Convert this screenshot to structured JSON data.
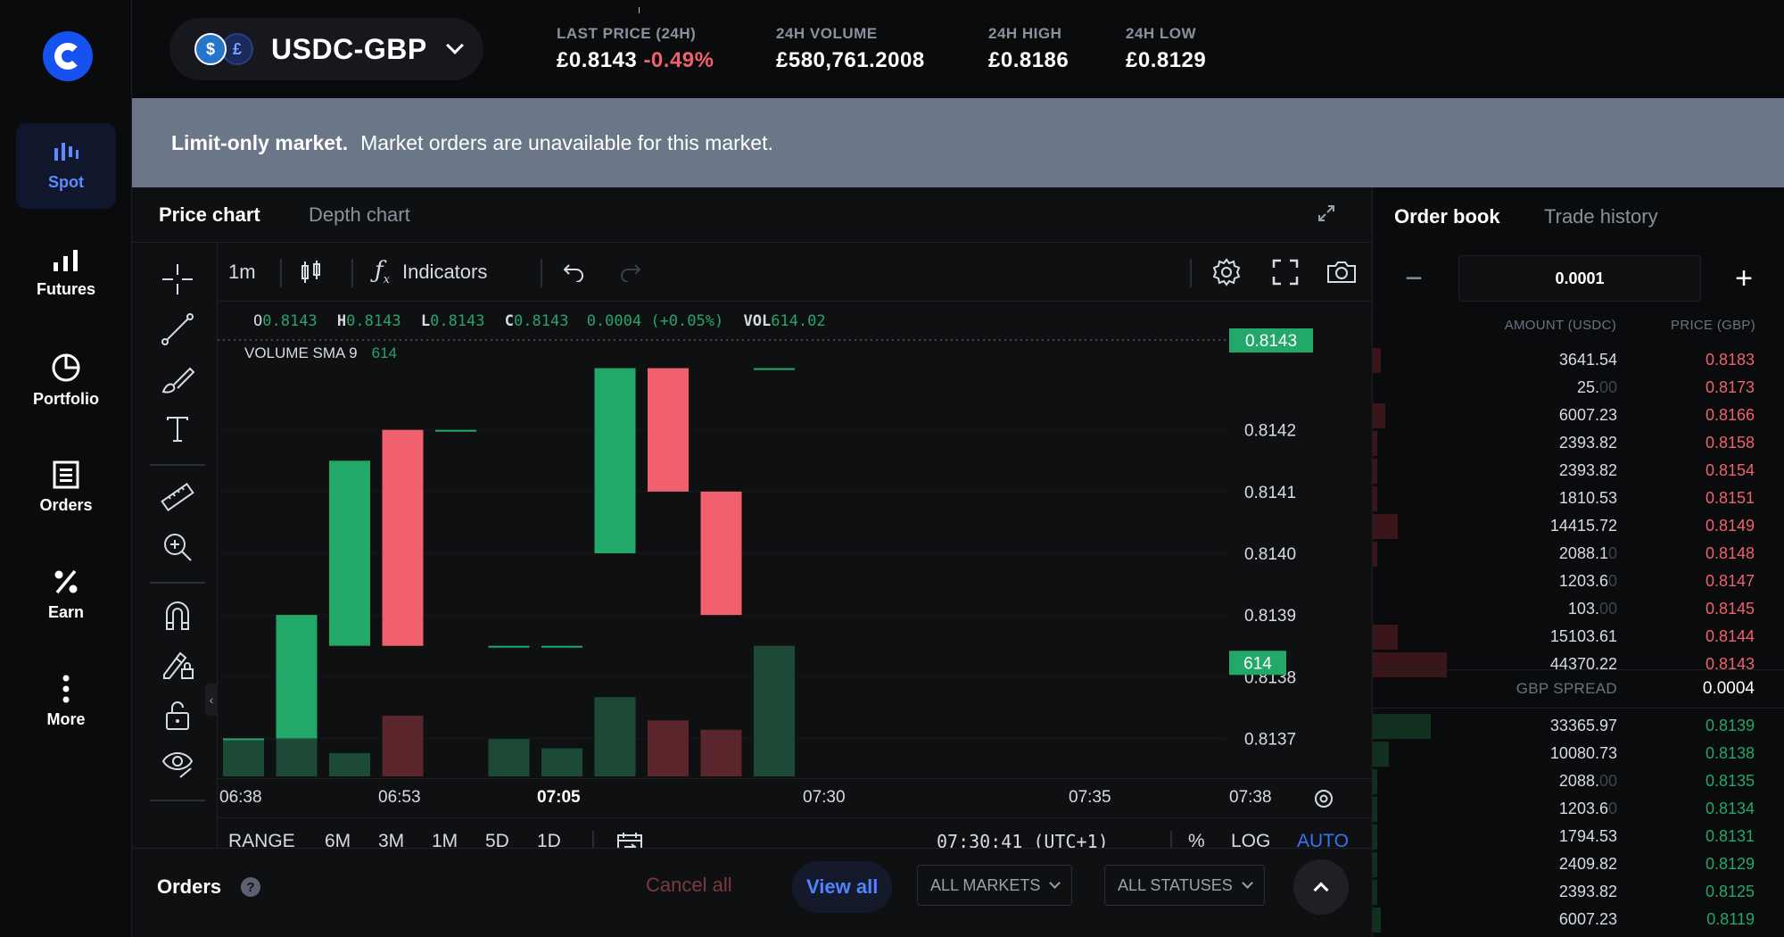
{
  "sidebar": {
    "items": [
      {
        "label": "Spot",
        "icon": "candlestick-icon"
      },
      {
        "label": "Futures",
        "icon": "bar-chart-icon"
      },
      {
        "label": "Portfolio",
        "icon": "pie-chart-icon"
      },
      {
        "label": "Orders",
        "icon": "document-list-icon"
      },
      {
        "label": "Earn",
        "icon": "percent-icon"
      },
      {
        "label": "More",
        "icon": "more-vertical-icon"
      }
    ]
  },
  "header": {
    "pair": "USDC-GBP",
    "coin_glyphs": {
      "base": "$",
      "quote": "£"
    },
    "stats": [
      {
        "key": "LAST PRICE (24H)",
        "value": "£0.8143",
        "change": "-0.49%"
      },
      {
        "key": "24H VOLUME",
        "value": "£580,761.2008"
      },
      {
        "key": "24H HIGH",
        "value": "£0.8186"
      },
      {
        "key": "24H LOW",
        "value": "£0.8129"
      }
    ]
  },
  "banner": {
    "bold": "Limit-only market.",
    "text": "Market orders are unavailable for this market."
  },
  "chart_tabs": {
    "price": "Price chart",
    "depth": "Depth chart"
  },
  "toolbar": {
    "interval": "1m",
    "indicators": "Indicators"
  },
  "ohlc": {
    "o_key": "O",
    "o": "0.8143",
    "h_key": "H",
    "h": "0.8143",
    "l_key": "L",
    "l": "0.8143",
    "c_key": "C",
    "c": "0.8143",
    "change": "0.0004 (+0.05%)",
    "vol_key": "VOL",
    "vol": "614.02"
  },
  "sma": {
    "label": "VOLUME SMA 9",
    "value": "614"
  },
  "price_tags": {
    "last": "0.8143",
    "volume": "614"
  },
  "colors": {
    "up": "#22a868",
    "down": "#f0616d",
    "up_vol": "#1d4a37",
    "down_vol": "#5a252b",
    "accent": "#3773f5"
  },
  "range_bar": {
    "range_label": "RANGE",
    "ranges": [
      "6M",
      "3M",
      "1M",
      "5D",
      "1D"
    ],
    "clock": "07:30:41 (UTC+1)",
    "percent": "%",
    "log": "LOG",
    "auto": "AUTO"
  },
  "chart_data": {
    "type": "candlestick",
    "y_ticks": [
      "0.8142",
      "0.8141",
      "0.8140",
      "0.8139",
      "0.8138",
      "0.8137"
    ],
    "ylim": [
      0.81365,
      0.81435
    ],
    "x_ticks": [
      {
        "label": "06:38",
        "bold": false
      },
      {
        "label": "06:53",
        "bold": false
      },
      {
        "label": "07:05",
        "bold": true
      },
      {
        "label": "07:30",
        "bold": false
      },
      {
        "label": "07:35",
        "bold": false
      },
      {
        "label": "07:38",
        "bold": false
      }
    ],
    "candles": [
      {
        "o": 0.8137,
        "c": 0.8137,
        "vol_frac": 0.08
      },
      {
        "o": 0.8137,
        "c": 0.8139,
        "vol_frac": 0.15
      },
      {
        "o": 0.81385,
        "c": 0.81415,
        "vol_frac": 0.05
      },
      {
        "o": 0.8142,
        "c": 0.81385,
        "vol_frac": 0.13
      },
      {
        "o": 0.8142,
        "c": 0.8142,
        "vol_frac": 0.0
      },
      {
        "o": 0.81385,
        "c": 0.81385,
        "vol_frac": 0.08
      },
      {
        "o": 0.81385,
        "c": 0.81385,
        "vol_frac": 0.06
      },
      {
        "o": 0.814,
        "c": 0.8143,
        "vol_frac": 0.17
      },
      {
        "o": 0.8143,
        "c": 0.8141,
        "vol_frac": 0.12
      },
      {
        "o": 0.8141,
        "c": 0.8139,
        "vol_frac": 0.1
      },
      {
        "o": 0.8143,
        "c": 0.8143,
        "vol_frac": 0.28
      }
    ]
  },
  "orders": {
    "title": "Orders",
    "help": "?",
    "cancel_all": "Cancel all",
    "view_all": "View all",
    "markets": "ALL MARKETS",
    "statuses": "ALL STATUSES"
  },
  "order_book": {
    "tabs": {
      "book": "Order book",
      "history": "Trade history"
    },
    "step": "0.0001",
    "minus": "−",
    "plus": "+",
    "amount_header": "AMOUNT (USDC)",
    "price_header": "PRICE (GBP)",
    "asks": [
      {
        "amount": "3641.54",
        "dim": "",
        "price": "0.8183",
        "depth": 0.02
      },
      {
        "amount": "25.",
        "dim": "00",
        "price": "0.8173",
        "depth": 0.0
      },
      {
        "amount": "6007.23",
        "dim": "",
        "price": "0.8166",
        "depth": 0.03
      },
      {
        "amount": "2393.82",
        "dim": "",
        "price": "0.8158",
        "depth": 0.01
      },
      {
        "amount": "2393.82",
        "dim": "",
        "price": "0.8154",
        "depth": 0.01
      },
      {
        "amount": "1810.53",
        "dim": "",
        "price": "0.8151",
        "depth": 0.01
      },
      {
        "amount": "14415.72",
        "dim": "",
        "price": "0.8149",
        "depth": 0.06
      },
      {
        "amount": "2088.1",
        "dim": "0",
        "price": "0.8148",
        "depth": 0.01
      },
      {
        "amount": "1203.6",
        "dim": "0",
        "price": "0.8147",
        "depth": 0.0
      },
      {
        "amount": "103.",
        "dim": "00",
        "price": "0.8145",
        "depth": 0.0
      },
      {
        "amount": "15103.61",
        "dim": "",
        "price": "0.8144",
        "depth": 0.06
      },
      {
        "amount": "44370.22",
        "dim": "",
        "price": "0.8143",
        "depth": 0.18
      }
    ],
    "spread_label": "GBP SPREAD",
    "spread_value": "0.0004",
    "bids": [
      {
        "amount": "33365.97",
        "dim": "",
        "price": "0.8139",
        "depth": 0.14
      },
      {
        "amount": "10080.73",
        "dim": "",
        "price": "0.8138",
        "depth": 0.04
      },
      {
        "amount": "2088.",
        "dim": "00",
        "price": "0.8135",
        "depth": 0.01
      },
      {
        "amount": "1203.6",
        "dim": "0",
        "price": "0.8134",
        "depth": 0.01
      },
      {
        "amount": "1794.53",
        "dim": "",
        "price": "0.8131",
        "depth": 0.01
      },
      {
        "amount": "2409.82",
        "dim": "",
        "price": "0.8129",
        "depth": 0.01
      },
      {
        "amount": "2393.82",
        "dim": "",
        "price": "0.8125",
        "depth": 0.01
      },
      {
        "amount": "6007.23",
        "dim": "",
        "price": "0.8119",
        "depth": 0.02
      }
    ]
  }
}
